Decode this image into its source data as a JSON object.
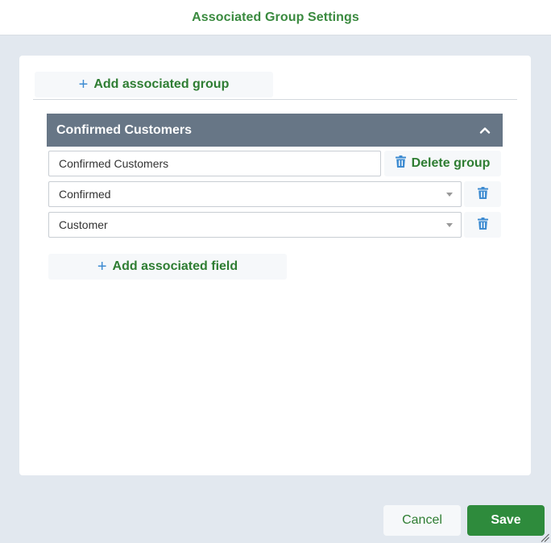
{
  "dialog": {
    "title": "Associated Group Settings"
  },
  "panel": {
    "add_group_label": "Add associated group",
    "group": {
      "header_title": "Confirmed Customers",
      "name_value": "Confirmed Customers",
      "delete_group_label": "Delete group",
      "fields": [
        {
          "value": "Confirmed"
        },
        {
          "value": "Customer"
        }
      ],
      "add_field_label": "Add associated field"
    }
  },
  "footer": {
    "cancel_label": "Cancel",
    "save_label": "Save"
  },
  "colors": {
    "accent_green": "#2e7d32",
    "save_green": "#2e8b3c",
    "header_slate": "#677686",
    "icon_blue": "#3d8bd1",
    "background": "#e2e8ef"
  },
  "icons": {
    "add": "plus-icon",
    "collapse": "chevron-up-icon",
    "delete": "trash-icon",
    "dropdown": "caret-down-icon",
    "resize": "resize-grip-icon"
  }
}
